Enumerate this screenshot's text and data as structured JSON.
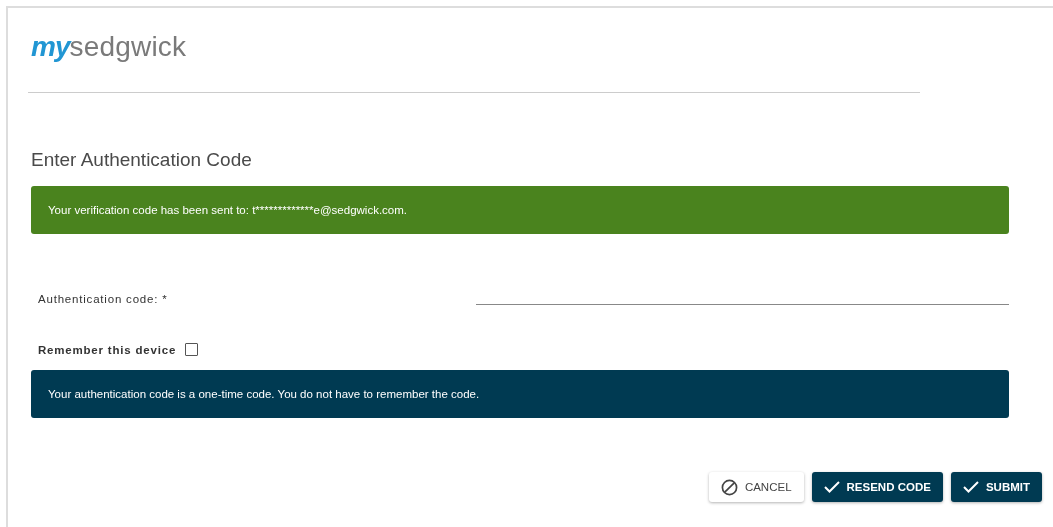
{
  "logo": {
    "prefix": "my",
    "name": "sedgwick"
  },
  "title": "Enter Authentication Code",
  "success_banner": "Your verification code has been sent to: t*************e@sedgwick.com.",
  "code_field": {
    "label": "Authentication code: *"
  },
  "remember_device": {
    "label": "Remember this device",
    "checked": false
  },
  "info_banner": "Your authentication code is a one-time code. You do not have to remember the code.",
  "buttons": [
    {
      "label": "CANCEL",
      "kind": "cancel"
    },
    {
      "label": "RESEND CODE",
      "kind": "primary"
    },
    {
      "label": "SUBMIT",
      "kind": "primary"
    }
  ]
}
